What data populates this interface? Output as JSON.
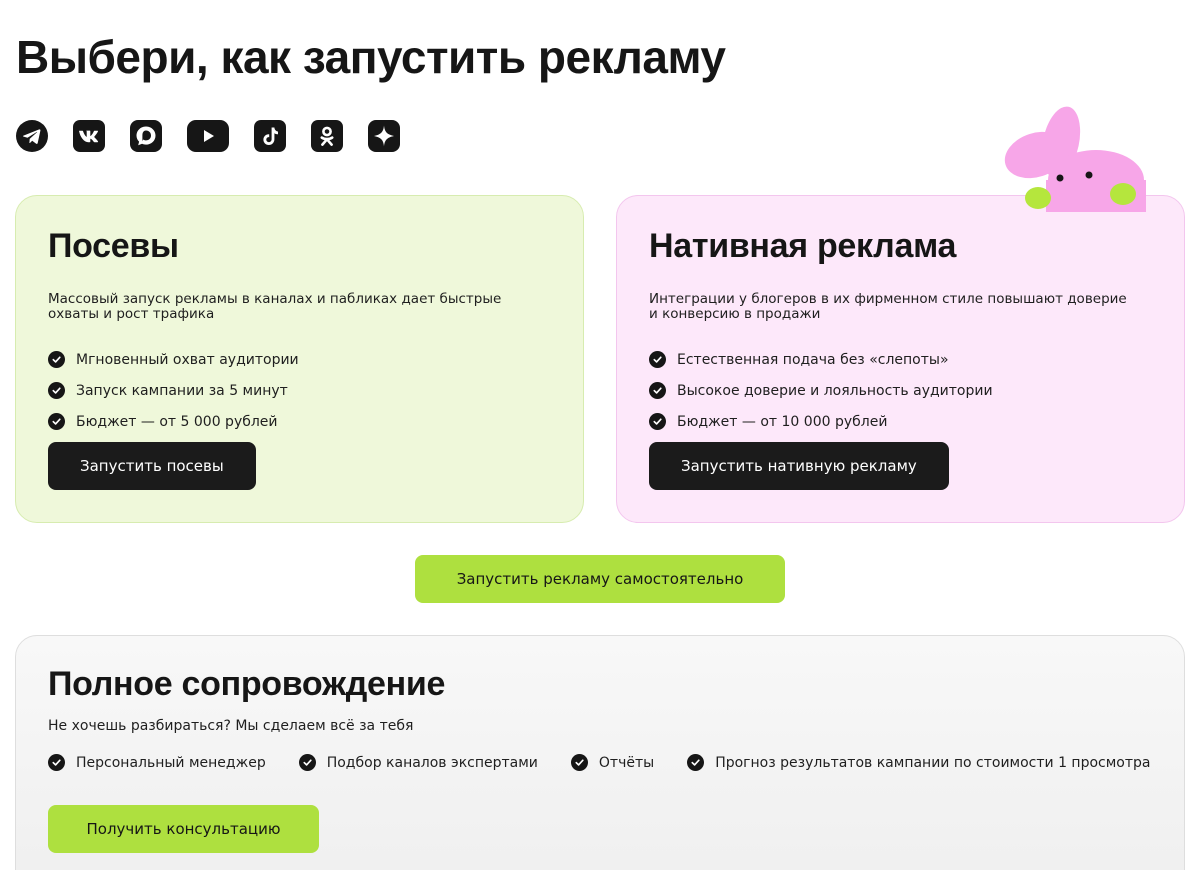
{
  "page": {
    "title": "Выбери, как запустить рекламу"
  },
  "socials": [
    {
      "icon": "telegram-icon"
    },
    {
      "icon": "vk-icon"
    },
    {
      "icon": "dzen-icon"
    },
    {
      "icon": "youtube-icon"
    },
    {
      "icon": "tiktok-icon"
    },
    {
      "icon": "odnoklassniki-icon"
    },
    {
      "icon": "sparkle-icon"
    }
  ],
  "colors": {
    "accent_green": "#aee03f",
    "seeding_bg": "#eff8da",
    "native_bg": "#fde8fa",
    "dark": "#1b1b1b",
    "bunny_pink": "#f7a6e8"
  },
  "cards": {
    "seeding": {
      "title": "Посевы",
      "description": "Массовый запуск рекламы в каналах и пабликах дает быстрые охваты и рост трафика",
      "features": [
        "Мгновенный охват аудитории",
        "Запуск кампании за 5 минут",
        "Бюджет — от 5 000 рублей"
      ],
      "button": "Запустить посевы"
    },
    "native": {
      "title": "Нативная реклама",
      "description": "Интеграции у блогеров в их фирменном стиле повышают доверие и конверсию в продажи",
      "features": [
        "Естественная подача без «слепоты»",
        "Высокое доверие и лояльность аудитории",
        "Бюджет — от 10 000 рублей"
      ],
      "button": "Запустить нативную рекламу"
    }
  },
  "self_launch": {
    "button": "Запустить рекламу самостоятельно"
  },
  "full_support": {
    "title": "Полное сопровождение",
    "description": "Не хочешь разбираться? Мы сделаем всё за тебя",
    "features": [
      "Персональный менеджер",
      "Подбор каналов экспертами",
      "Отчёты",
      "Прогноз результатов кампании по стоимости 1 просмотра"
    ],
    "button": "Получить консультацию"
  }
}
